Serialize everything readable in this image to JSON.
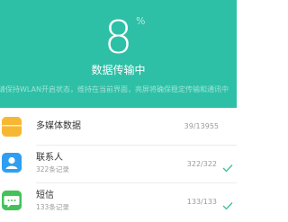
{
  "header": {
    "percent": "8",
    "percent_unit": "%",
    "status": "数据传输中",
    "hint": "请保持WLAN开启状态，维持在当前界面，亮屏将确保稳定传输和通讯中"
  },
  "items": [
    {
      "icon": "folder-icon",
      "title": "多媒体数据",
      "subtitle": "",
      "count": "39/13955",
      "done": false
    },
    {
      "icon": "contacts-icon",
      "title": "联系人",
      "subtitle": "322条记录",
      "count": "322/322",
      "done": true
    },
    {
      "icon": "messages-icon",
      "title": "短信",
      "subtitle": "133条记录",
      "count": "133/133",
      "done": true
    }
  ],
  "colors": {
    "header_bg": "#2ec0a7",
    "folder": "#f6b832",
    "contacts": "#2f9ef2",
    "messages": "#44c25a",
    "check": "#3cbf9a"
  }
}
